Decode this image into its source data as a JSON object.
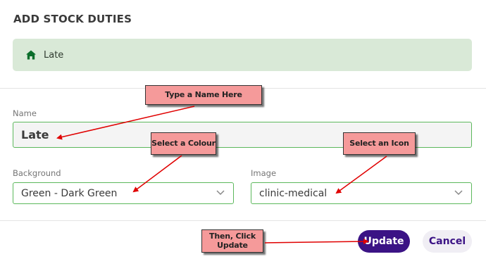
{
  "dialog": {
    "title": "ADD STOCK DUTIES",
    "preview_label": "Late",
    "preview_icon": "home-icon",
    "preview_color": "#0b6e2b"
  },
  "form": {
    "name_label": "Name",
    "name_value": "Late",
    "background_label": "Background",
    "background_value": "Green - Dark Green",
    "image_label": "Image",
    "image_value": "clinic-medical"
  },
  "buttons": {
    "update": "Update",
    "cancel": "Cancel"
  },
  "annotations": {
    "name_hint": "Type a Name Here",
    "colour_hint": "Select a Colour",
    "icon_hint": "Select an Icon",
    "update_hint_line1": "Then, Click",
    "update_hint_line2": "Update"
  },
  "colors": {
    "accent": "#3b1385",
    "field_border": "#5cb85c",
    "callout_fill": "#f59a9a",
    "arrow": "#e00000"
  }
}
